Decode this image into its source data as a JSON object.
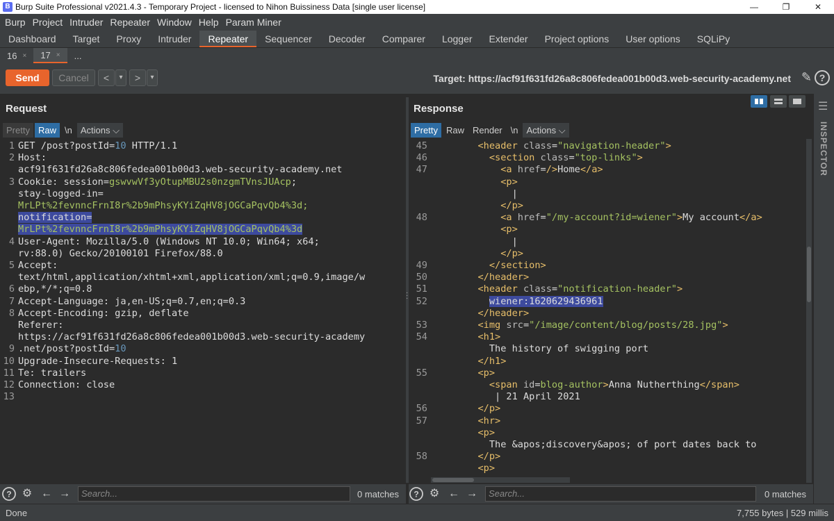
{
  "window": {
    "title": "Burp Suite Professional v2021.4.3 - Temporary Project - licensed to Nihon Buissiness Data [single user license]",
    "minimize": "—",
    "restore": "❐",
    "close": "✕"
  },
  "menu": [
    "Burp",
    "Project",
    "Intruder",
    "Repeater",
    "Window",
    "Help",
    "Param Miner"
  ],
  "tool_tabs": [
    "Dashboard",
    "Target",
    "Proxy",
    "Intruder",
    "Repeater",
    "Sequencer",
    "Decoder",
    "Comparer",
    "Logger",
    "Extender",
    "Project options",
    "User options",
    "SQLiPy"
  ],
  "active_tool_tab": "Repeater",
  "repeater_tabs": [
    {
      "label": "16",
      "close": "×"
    },
    {
      "label": "17",
      "close": "×"
    },
    {
      "label": "...",
      "close": ""
    }
  ],
  "actions": {
    "send": "Send",
    "cancel": "Cancel",
    "back": "<",
    "back_menu": "▾",
    "forward": ">",
    "forward_menu": "▾",
    "target": "Target: https://acf91f631fd26a8c806fedea001b00d3.web-security-academy.net"
  },
  "request": {
    "title": "Request",
    "buttons": {
      "pretty": "Pretty",
      "raw": "Raw",
      "newline": "\\n",
      "actions": "Actions"
    },
    "line_numbers": [
      "1",
      "2",
      "",
      "3",
      "",
      "",
      "",
      "",
      "4",
      "",
      "5",
      "",
      "6",
      "7",
      "8",
      "",
      "",
      "9",
      "10",
      "11",
      "12",
      "13"
    ],
    "lines": [
      "GET /post?postId=10 HTTP/1.1",
      "Host:",
      "acf91f631fd26a8c806fedea001b00d3.web-security-academy.net",
      "Cookie: session=gswvwVf3yOtupMBU2s0nzgmTVnsJUAcp;",
      "stay-logged-in=",
      "MrLPt%2fevnncFrnI8r%2b9mPhsyKYiZqHV8jOGCaPqvQb4%3d;",
      "notification=",
      "MrLPt%2fevnncFrnI8r%2b9mPhsyKYiZqHV8jOGCaPqvQb4%3d",
      "User-Agent: Mozilla/5.0 (Windows NT 10.0; Win64; x64;",
      "rv:88.0) Gecko/20100101 Firefox/88.0",
      "Accept:",
      "text/html,application/xhtml+xml,application/xml;q=0.9,image/w",
      "ebp,*/*;q=0.8",
      "Accept-Language: ja,en-US;q=0.7,en;q=0.3",
      "Accept-Encoding: gzip, deflate",
      "Referer:",
      "https://acf91f631fd26a8c806fedea001b00d3.web-security-academy",
      ".net/post?postId=10",
      "Upgrade-Insecure-Requests: 1",
      "Te: trailers",
      "Connection: close",
      ""
    ],
    "search_placeholder": "Search...",
    "matches": "0 matches"
  },
  "response": {
    "title": "Response",
    "buttons": {
      "pretty": "Pretty",
      "raw": "Raw",
      "render": "Render",
      "newline": "\\n",
      "actions": "Actions"
    },
    "line_numbers": [
      "45",
      "46",
      "47",
      "",
      "",
      "",
      "48",
      "",
      "",
      "",
      "49",
      "50",
      "51",
      "52",
      "",
      "53",
      "54",
      "",
      "",
      "55",
      "",
      "",
      "56",
      "57",
      "",
      "",
      "58"
    ],
    "lines": [
      "        <header class=\"navigation-header\">",
      "          <section class=\"top-links\">",
      "            <a href=/>Home</a>",
      "            <p>",
      "              |",
      "            </p>",
      "            <a href=\"/my-account?id=wiener\">My account</a>",
      "            <p>",
      "              |",
      "            </p>",
      "          </section>",
      "        </header>",
      "        <header class=\"notification-header\">",
      "          wiener:1620629436961",
      "        </header>",
      "        <img src=\"/image/content/blog/posts/28.jpg\">",
      "        <h1>",
      "          The history of swigging port",
      "        </h1>",
      "        <p>",
      "          <span id=blog-author>Anna Nutherthing</span>",
      "           | 21 April 2021",
      "        </p>",
      "        <hr>",
      "        <p>",
      "          The &apos;discovery&apos; of port dates back to",
      "        </p>",
      "        <p>"
    ],
    "search_placeholder": "Search...",
    "matches": "0 matches"
  },
  "inspector_label": "INSPECTOR",
  "status": {
    "left": "Done",
    "right": "7,755 bytes | 529 millis"
  },
  "colors": {
    "accent": "#e8642c",
    "selection": "#3d4a9e",
    "button_active": "#2e6da4"
  }
}
